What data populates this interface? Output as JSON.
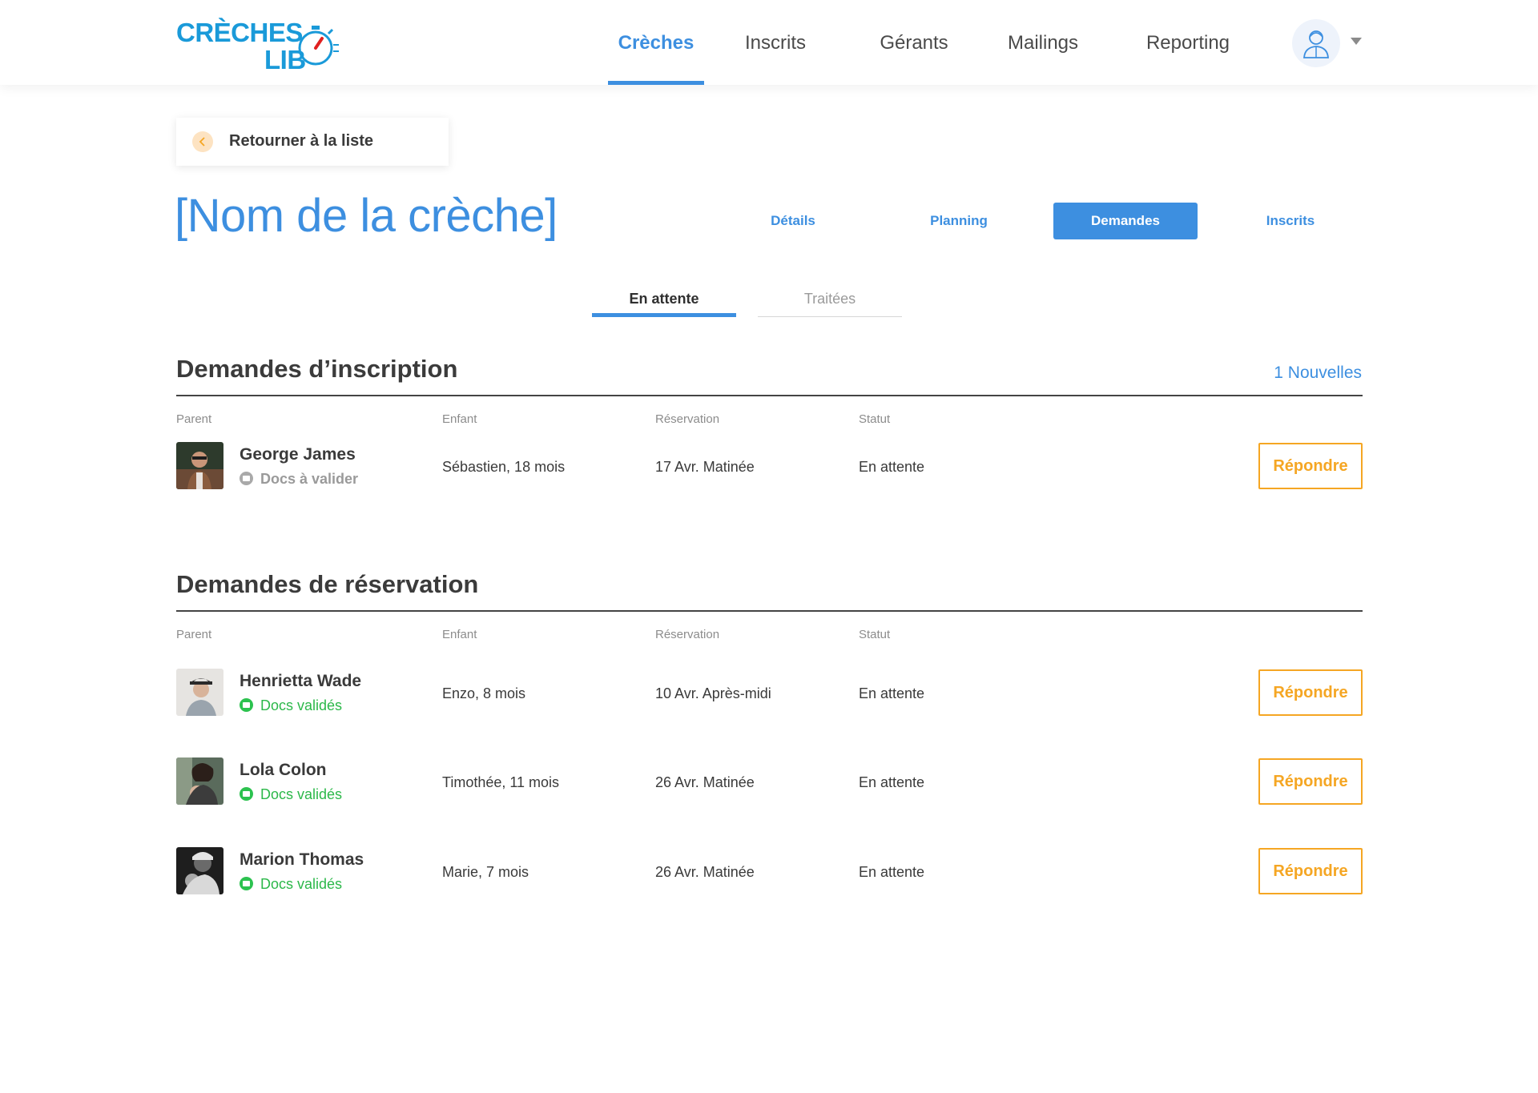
{
  "brand": {
    "line1": "CRÈCHES",
    "line2": "LIB"
  },
  "nav": {
    "items": [
      "Crèches",
      "Inscrits",
      "Gérants",
      "Mailings",
      "Reporting"
    ],
    "active": "Crèches"
  },
  "back": {
    "label": "Retourner à la liste"
  },
  "page": {
    "title": "[Nom de la crèche]"
  },
  "section_tabs": [
    "Détails",
    "Planning",
    "Demandes",
    "Inscrits"
  ],
  "sub_tabs": [
    "En attente",
    "Traitées"
  ],
  "columns": {
    "parent": "Parent",
    "child": "Enfant",
    "reservation": "Réservation",
    "status": "Statut"
  },
  "inscriptions": {
    "title": "Demandes d’inscription",
    "new_count": "1 Nouvelles",
    "rows": [
      {
        "parent": "George James",
        "docs": "Docs à valider",
        "child": "Sébastien, 18 mois",
        "reservation": "17 Avr. Matinée",
        "status": "En attente",
        "action": "Répondre"
      }
    ]
  },
  "reservations": {
    "title": "Demandes de réservation",
    "rows": [
      {
        "parent": "Henrietta Wade",
        "docs": "Docs validés",
        "child": "Enzo, 8 mois",
        "reservation": "10 Avr. Après-midi",
        "status": "En attente",
        "action": "Répondre"
      },
      {
        "parent": "Lola Colon",
        "docs": "Docs validés",
        "child": "Timothée, 11 mois",
        "reservation": "26 Avr. Matinée",
        "status": "En attente",
        "action": "Répondre"
      },
      {
        "parent": "Marion Thomas",
        "docs": "Docs validés",
        "child": "Marie, 7 mois",
        "reservation": "26 Avr. Matinée",
        "status": "En attente",
        "action": "Répondre"
      }
    ]
  },
  "colors": {
    "accent": "#3d8fe0",
    "brand": "#1a9ad9",
    "action": "#f5a623",
    "ok": "#2cc24f",
    "pending": "#a9a9a9"
  },
  "icons": {
    "back": "chevron-left-icon",
    "user": "user-avatar-icon",
    "menu": "caret-down-icon",
    "docs": "folder-icon",
    "logo": "stopwatch-icon"
  }
}
